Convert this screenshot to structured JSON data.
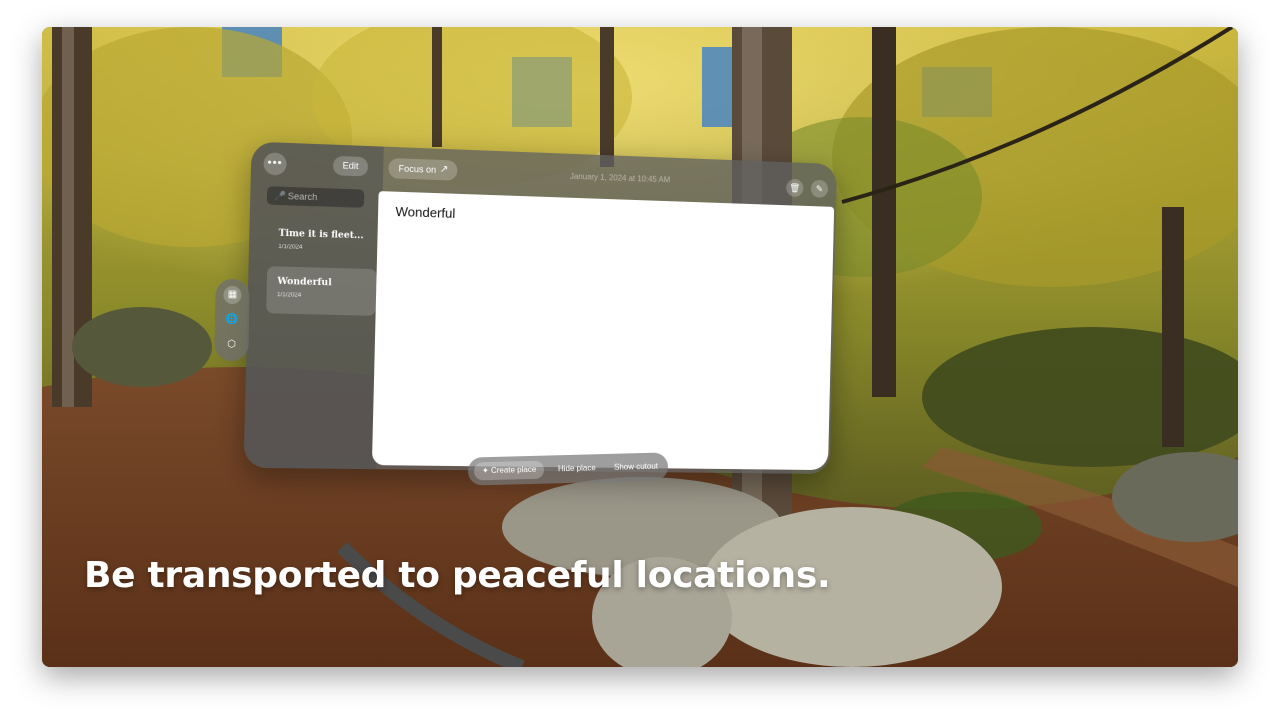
{
  "sidebar": {
    "more_icon": "ellipsis-icon",
    "edit_label": "Edit",
    "search_placeholder": "Search",
    "search_icon": "microphone-icon",
    "notes": [
      {
        "title": "Time it is fleet...",
        "date": "1/1/2024"
      },
      {
        "title": "Wonderful",
        "date": "1/1/2024",
        "selected": true
      }
    ]
  },
  "header": {
    "focus_label": "Focus on",
    "focus_icon": "expand-arrows-icon",
    "date": "January 1, 2024 at 10:45 AM",
    "trash_icon": "trash-icon",
    "compose_icon": "compose-icon"
  },
  "editor": {
    "text": "Wonderful"
  },
  "ornament": {
    "icons": [
      "notes-icon",
      "globe-icon",
      "cube-icon"
    ]
  },
  "toolbar": {
    "create_label": "Create place",
    "hide_label": "Hide place",
    "cutout_label": "Show cutout"
  },
  "caption": "Be transported to peaceful locations.",
  "colors": {
    "editor_bg": "#ffffff",
    "glass": "#5f5f5f",
    "caption": "#ffffff"
  }
}
